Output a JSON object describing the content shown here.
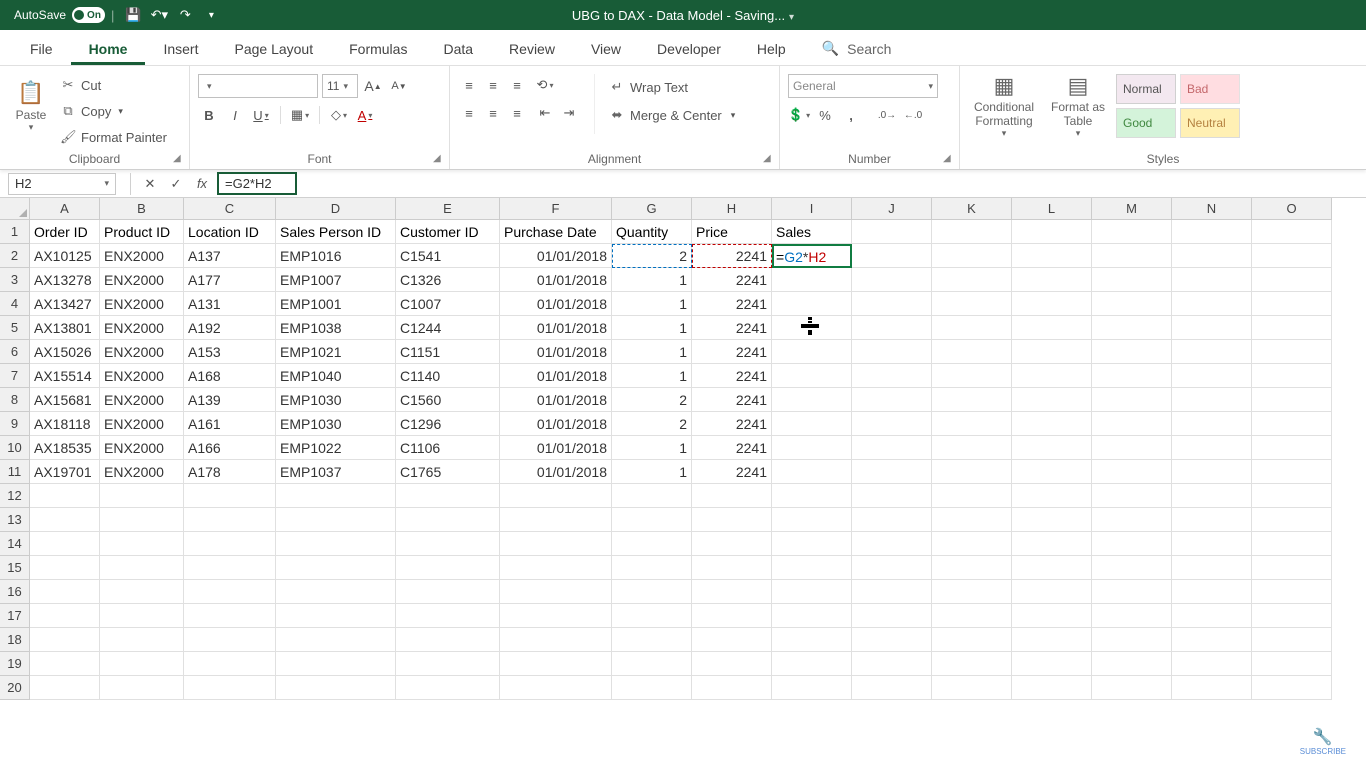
{
  "titlebar": {
    "autosave_label": "AutoSave",
    "autosave_state": "On",
    "doc_title": "UBG to DAX - Data Model - Saving..."
  },
  "tabs": {
    "items": [
      "File",
      "Home",
      "Insert",
      "Page Layout",
      "Formulas",
      "Data",
      "Review",
      "View",
      "Developer",
      "Help"
    ],
    "active_index": 1,
    "search_label": "Search"
  },
  "ribbon": {
    "clipboard": {
      "label": "Clipboard",
      "paste": "Paste",
      "cut": "Cut",
      "copy": "Copy",
      "format_painter": "Format Painter"
    },
    "font": {
      "label": "Font",
      "font_name": "",
      "font_size": "11"
    },
    "alignment": {
      "label": "Alignment",
      "wrap_text": "Wrap Text",
      "merge_center": "Merge & Center"
    },
    "number": {
      "label": "Number",
      "format": "General"
    },
    "styles": {
      "label": "Styles",
      "cond_fmt": "Conditional\nFormatting",
      "fmt_table": "Format as\nTable",
      "normal": "Normal",
      "bad": "Bad",
      "good": "Good",
      "neutral": "Neutral"
    }
  },
  "formula_bar": {
    "name_box": "H2",
    "formula": "=G2*H2"
  },
  "grid": {
    "columns": [
      {
        "letter": "A",
        "width": 70
      },
      {
        "letter": "B",
        "width": 84
      },
      {
        "letter": "C",
        "width": 92
      },
      {
        "letter": "D",
        "width": 120
      },
      {
        "letter": "E",
        "width": 104
      },
      {
        "letter": "F",
        "width": 112
      },
      {
        "letter": "G",
        "width": 80
      },
      {
        "letter": "H",
        "width": 80
      },
      {
        "letter": "I",
        "width": 80
      },
      {
        "letter": "J",
        "width": 80
      },
      {
        "letter": "K",
        "width": 80
      },
      {
        "letter": "L",
        "width": 80
      },
      {
        "letter": "M",
        "width": 80
      },
      {
        "letter": "N",
        "width": 80
      },
      {
        "letter": "O",
        "width": 80
      }
    ],
    "header_row": [
      "Order ID",
      "Product ID",
      "Location ID",
      "Sales Person ID",
      "Customer ID",
      "Purchase Date",
      "Quantity",
      "Price",
      "Sales"
    ],
    "rows": [
      [
        "AX10125",
        "ENX2000",
        "A137",
        "EMP1016",
        "C1541",
        "01/01/2018",
        "2",
        "2241",
        ""
      ],
      [
        "AX13278",
        "ENX2000",
        "A177",
        "EMP1007",
        "C1326",
        "01/01/2018",
        "1",
        "2241",
        ""
      ],
      [
        "AX13427",
        "ENX2000",
        "A131",
        "EMP1001",
        "C1007",
        "01/01/2018",
        "1",
        "2241",
        ""
      ],
      [
        "AX13801",
        "ENX2000",
        "A192",
        "EMP1038",
        "C1244",
        "01/01/2018",
        "1",
        "2241",
        ""
      ],
      [
        "AX15026",
        "ENX2000",
        "A153",
        "EMP1021",
        "C1151",
        "01/01/2018",
        "1",
        "2241",
        ""
      ],
      [
        "AX15514",
        "ENX2000",
        "A168",
        "EMP1040",
        "C1140",
        "01/01/2018",
        "1",
        "2241",
        ""
      ],
      [
        "AX15681",
        "ENX2000",
        "A139",
        "EMP1030",
        "C1560",
        "01/01/2018",
        "2",
        "2241",
        ""
      ],
      [
        "AX18118",
        "ENX2000",
        "A161",
        "EMP1030",
        "C1296",
        "01/01/2018",
        "2",
        "2241",
        ""
      ],
      [
        "AX18535",
        "ENX2000",
        "A166",
        "EMP1022",
        "C1106",
        "01/01/2018",
        "1",
        "2241",
        ""
      ],
      [
        "AX19701",
        "ENX2000",
        "A178",
        "EMP1037",
        "C1765",
        "01/01/2018",
        "1",
        "2241",
        ""
      ]
    ],
    "edit_cell_parts": {
      "eq": "=",
      "ref1": "G2",
      "op": "*",
      "ref2": "H2"
    },
    "total_visible_rows": 20
  },
  "subscribe_label": "SUBSCRIBE"
}
